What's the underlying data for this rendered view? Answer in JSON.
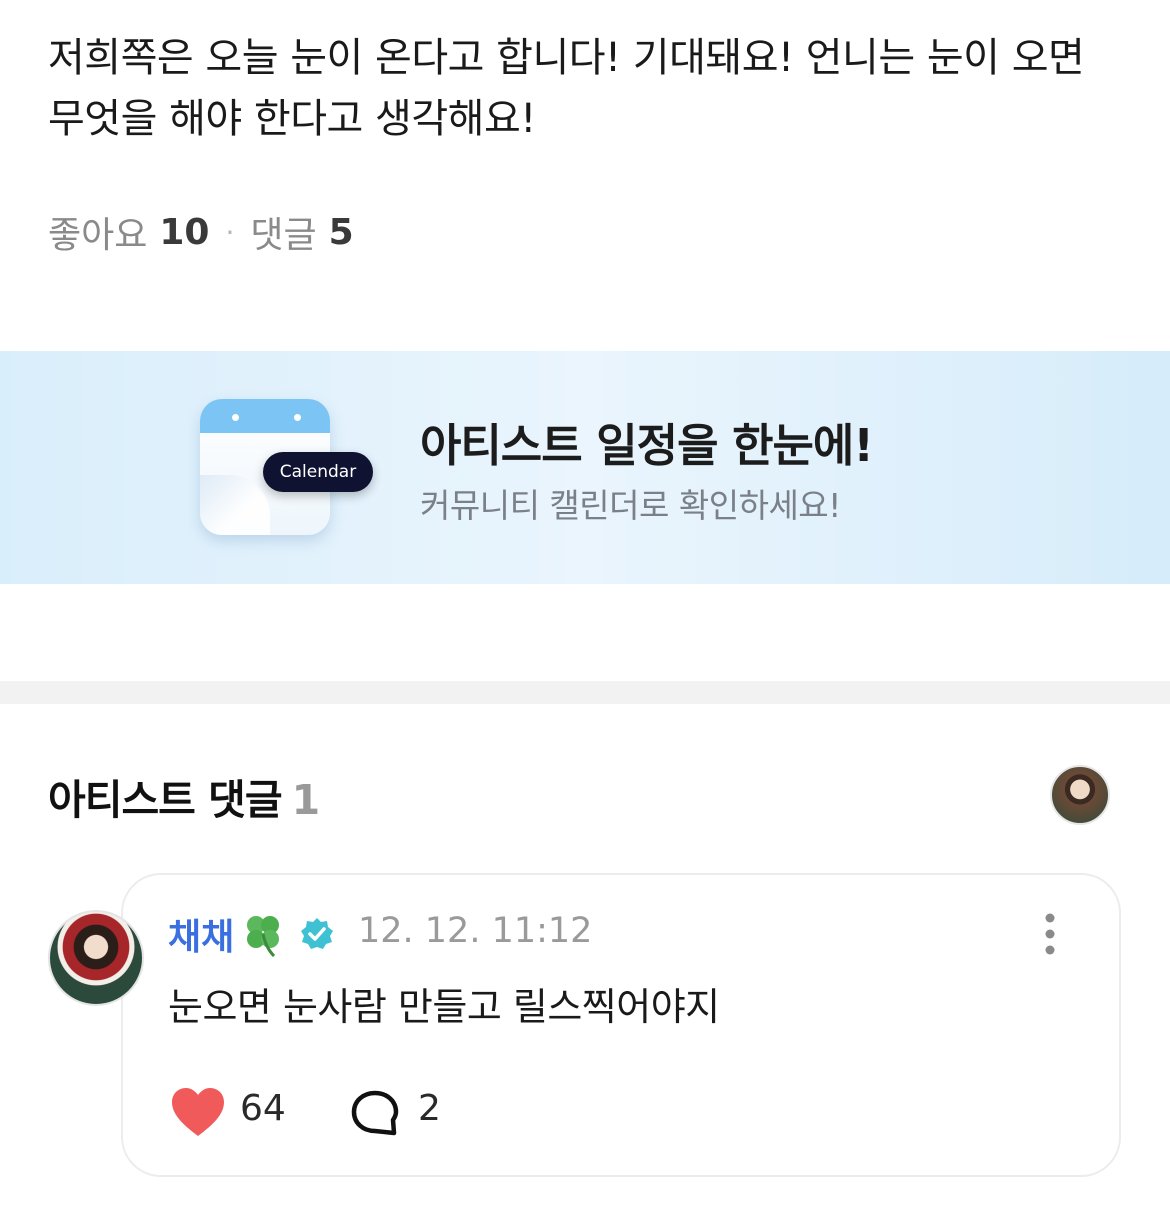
{
  "post": {
    "body": "저희쪽은 오늘 눈이 온다고 합니다! 기대돼요! 언니는 눈이 오면 무엇을 해야 한다고 생각해요!",
    "likes_label": "좋아요",
    "likes_count": "10",
    "separator": "·",
    "comments_label": "댓글",
    "comments_count": "5"
  },
  "banner": {
    "badge": "Calendar",
    "title": "아티스트 일정을 한눈에!",
    "subtitle": "커뮤니티 캘린더로 확인하세요!"
  },
  "artist_comments": {
    "heading": "아티스트 댓글",
    "count": "1"
  },
  "comment": {
    "author": "채채",
    "author_emoji": "clover-icon",
    "verified_icon": "verified-badge-icon",
    "time": "12. 12. 11:12",
    "text": "눈오면 눈사람 만들고 릴스찍어야지",
    "like_count": "64",
    "reply_count": "2"
  },
  "colors": {
    "author_name": "#3b6fe0",
    "heart": "#f05a5a",
    "verified": "#3ec1d3",
    "banner_bg": "#e3f2fc"
  }
}
